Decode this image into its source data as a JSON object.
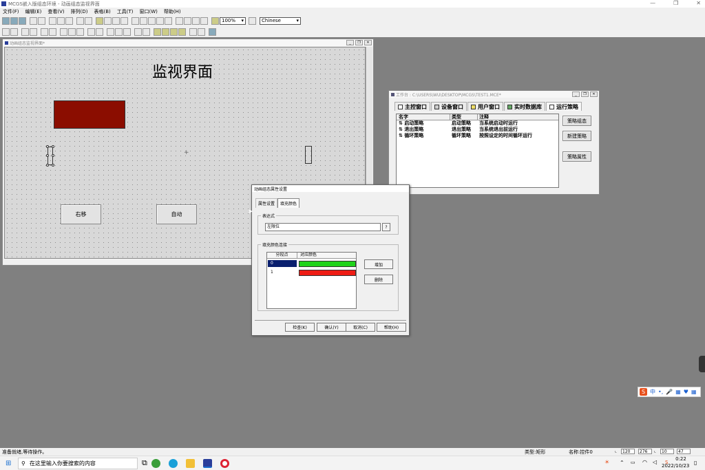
{
  "app": {
    "title": "MCGS嵌入版组态环境 - 动画组态监视界面",
    "icon": "mcgs-app-icon"
  },
  "menu": [
    "文件(F)",
    "编辑(E)",
    "查看(V)",
    "排列(D)",
    "表格(B)",
    "工具(T)",
    "窗口(W)",
    "帮助(H)"
  ],
  "toolbar": {
    "zoom": "100%",
    "language": "Chinese"
  },
  "monitor_window": {
    "title": "动画组态监视界面*",
    "heading": "监视界面",
    "buttons": {
      "right": "右移",
      "auto": "自动"
    },
    "rect_color": "#8b0d00"
  },
  "workspace": {
    "title": "工作台 : C:\\USERS\\WU\\DESKTOP\\MCGS\\TEST1.MCE*",
    "tabs": [
      {
        "label": "主控窗口",
        "icon": "main-window-icon"
      },
      {
        "label": "设备窗口",
        "icon": "device-window-icon"
      },
      {
        "label": "用户窗口",
        "icon": "user-window-icon"
      },
      {
        "label": "实时数据库",
        "icon": "database-icon"
      },
      {
        "label": "运行策略",
        "icon": "strategy-icon"
      }
    ],
    "columns": [
      "名字",
      "类型",
      "注释"
    ],
    "rows": [
      {
        "name": "启动策略",
        "type": "启动策略",
        "note": "当系统启动时运行"
      },
      {
        "name": "退出策略",
        "type": "退出策略",
        "note": "当系统退出前运行"
      },
      {
        "name": "循环策略",
        "type": "循环策略",
        "note": "按照设定的时间循环运行"
      }
    ],
    "buttons": {
      "edit": "策略组态",
      "new": "新建策略",
      "props": "策略属性"
    }
  },
  "dialog": {
    "title": "动画组态属性设置",
    "tabs": [
      "属性设置",
      "填充颜色"
    ],
    "expr_group": "表达式",
    "expr_value": "左限位",
    "expr_button": "?",
    "color_group": "填充颜色连接",
    "table_cols": [
      "分段点",
      "对应颜色"
    ],
    "segments": [
      {
        "point": "0",
        "color": "#1fd31a"
      },
      {
        "point": "1",
        "color": "#ee1c15"
      }
    ],
    "add": "增加",
    "delete": "删除",
    "footer": {
      "check": "检查(K)",
      "ok": "确认(Y)",
      "cancel": "取消(C)",
      "help": "帮助(H)"
    }
  },
  "status": {
    "left": "准备就绪,等待操作。",
    "type": "类型:矩形",
    "name": "名称:控件0",
    "x": "120",
    "y": "276",
    "w": "10",
    "h": "47"
  },
  "taskbar": {
    "search_placeholder": "在这里输入你要搜索的内容",
    "time": "0:22",
    "date": "2022/10/23",
    "ime_zh": "中"
  }
}
